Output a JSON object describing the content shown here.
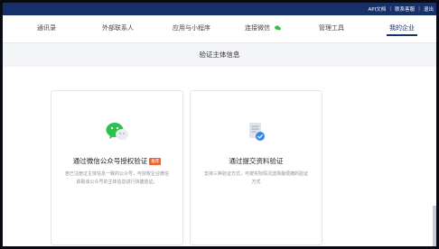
{
  "topbar": {
    "links": [
      "API文档",
      "联系客服",
      "退出"
    ]
  },
  "nav": {
    "tabs": [
      {
        "label": "通讯录"
      },
      {
        "label": "外部联系人"
      },
      {
        "label": "应用与小程序"
      },
      {
        "label": "连接微信"
      },
      {
        "label": "管理工具"
      },
      {
        "label": "我的企业"
      }
    ],
    "active_tab": "我的企业"
  },
  "section": {
    "title": "验证主体信息"
  },
  "cards": [
    {
      "title": "通过微信公众号授权验证",
      "badge": "推荐",
      "desc": "若已注册过主体信息一致的公众号，可授权企业微信获取该公众号的主体信息进行快捷验证。",
      "icon": "wechat-icon"
    },
    {
      "title": "通过提交资料验证",
      "desc": "支持三种验证方式，可按实际情况选择最便捷的验证方式",
      "icon": "document-check-icon"
    }
  ],
  "colors": {
    "header_bg": "#16306b",
    "accent_green": "#2bc14a",
    "badge": "#f5632a",
    "doc_blue": "#3a86e8"
  }
}
